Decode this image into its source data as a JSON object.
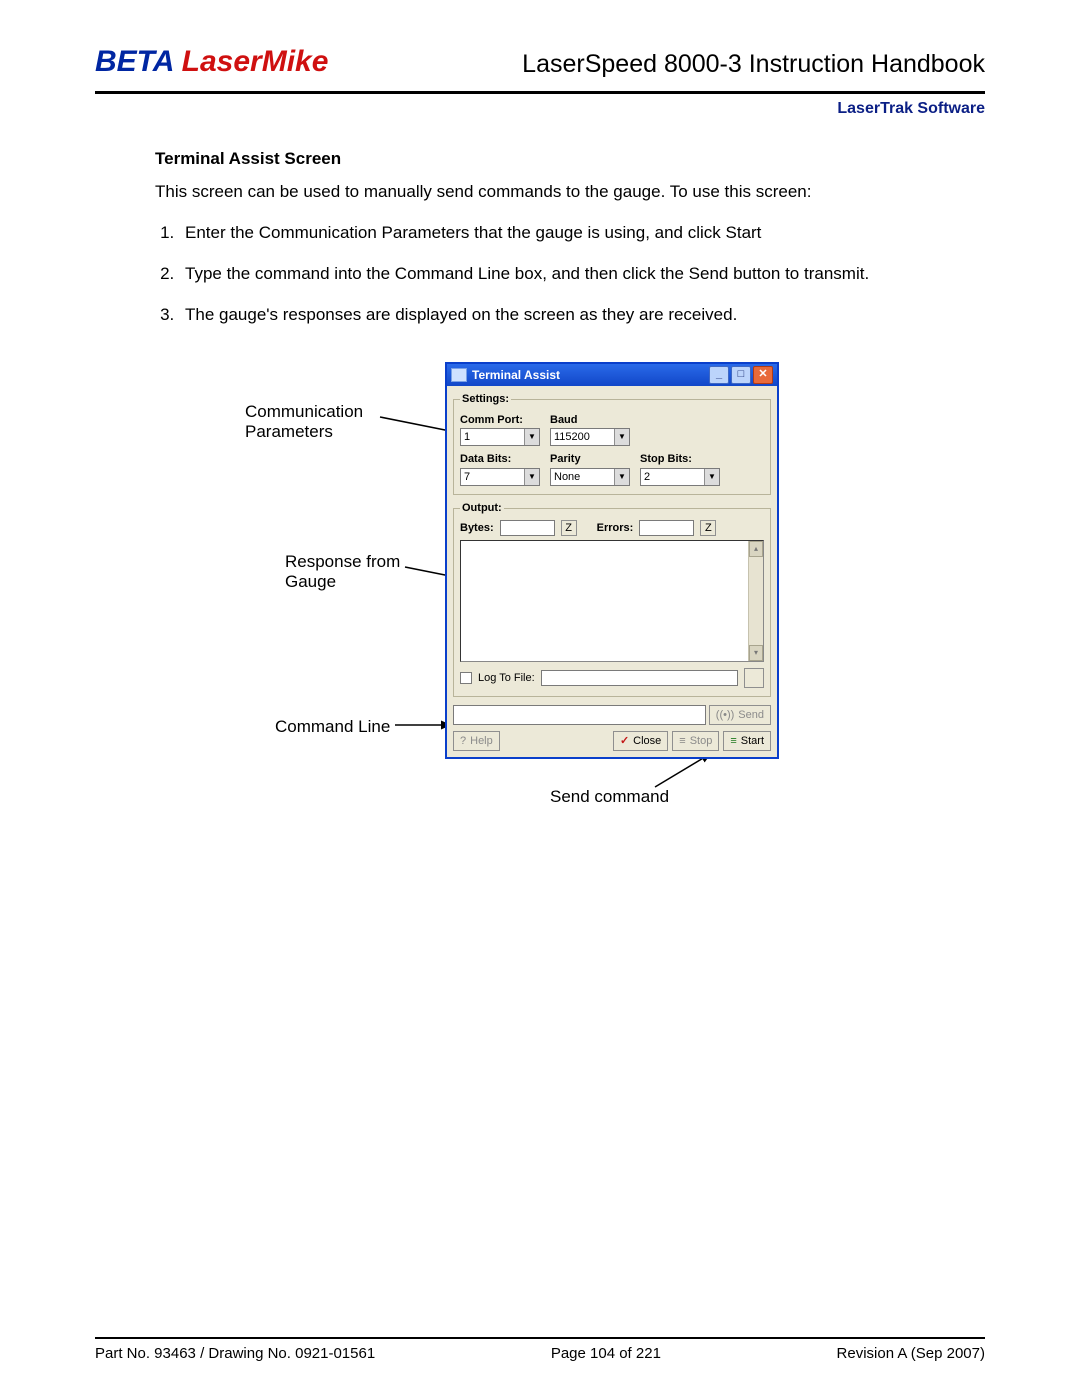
{
  "header": {
    "logo_beta": "BETA",
    "logo_lm": "LaserMike",
    "title": "LaserSpeed 8000-3 Instruction Handbook",
    "subtitle": "LaserTrak Software"
  },
  "body": {
    "section_title": "Terminal Assist Screen",
    "intro": "This screen can be used to manually send commands to the gauge.  To use this screen:",
    "steps": [
      "Enter the Communication Parameters that the gauge is using, and click Start",
      "Type the command into the Command Line box, and then click the Send button to transmit.",
      "The gauge's responses are displayed on the screen as they are received."
    ]
  },
  "callouts": {
    "comm_params": "Communication Parameters",
    "response": "Response from Gauge",
    "cmd_line": "Command Line",
    "send_cmd": "Send command"
  },
  "win": {
    "title": "Terminal Assist",
    "settings": {
      "legend": "Settings:",
      "comm_port_label": "Comm Port:",
      "comm_port_value": "1",
      "baud_label": "Baud",
      "baud_value": "115200",
      "databits_label": "Data Bits:",
      "databits_value": "7",
      "parity_label": "Parity",
      "parity_value": "None",
      "stopbits_label": "Stop Bits:",
      "stopbits_value": "2"
    },
    "output": {
      "legend": "Output:",
      "bytes_label": "Bytes:",
      "bytes_value": "",
      "z1": "Z",
      "errors_label": "Errors:",
      "errors_value": "",
      "z2": "Z",
      "log_label": "Log To File:",
      "log_value": ""
    },
    "cmd_value": "",
    "buttons": {
      "send": "Send",
      "help": "Help",
      "close": "Close",
      "stop": "Stop",
      "start": "Start"
    }
  },
  "footer": {
    "left": "Part No. 93463 / Drawing No. 0921-01561",
    "center": "Page 104 of 221",
    "right": "Revision A (Sep 2007)"
  }
}
